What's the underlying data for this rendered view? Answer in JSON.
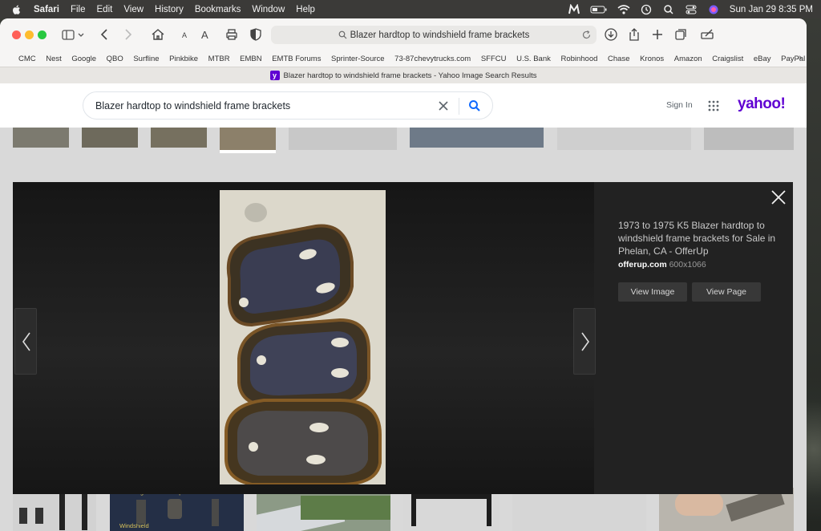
{
  "menubar": {
    "app": "Safari",
    "items": [
      "File",
      "Edit",
      "View",
      "History",
      "Bookmarks",
      "Window",
      "Help"
    ],
    "clock": "Sun Jan 29  8:35 PM"
  },
  "browser": {
    "address": "Blazer hardtop to windshield frame brackets",
    "favorites": [
      "CMC",
      "Nest",
      "Google",
      "QBO",
      "Surfline",
      "Pinkbike",
      "MTBR",
      "EMBN",
      "EMTB Forums",
      "Sprinter-Source",
      "73-87chevytrucks.com",
      "SFFCU",
      "U.S. Bank",
      "Robinhood",
      "Chase",
      "Kronos",
      "Amazon",
      "Craigslist",
      "eBay",
      "PayPal"
    ],
    "tab_title": "Blazer hardtop to windshield frame brackets - Yahoo Image Search Results"
  },
  "yahoo": {
    "query": "Blazer hardtop to windshield frame brackets",
    "sign_in": "Sign In",
    "logo": "yahoo!"
  },
  "viewer": {
    "title": "1973 to 1975 K5 Blazer hardtop to windshield frame brackets for Sale in Phelan, CA - OfferUp",
    "source": "offerup.com",
    "dimensions": "600x1066",
    "view_image": "View Image",
    "view_page": "View Page"
  },
  "bottom_thumbs": {
    "caption1": "Single wall hardtop bolts",
    "caption2": "Windshield"
  }
}
